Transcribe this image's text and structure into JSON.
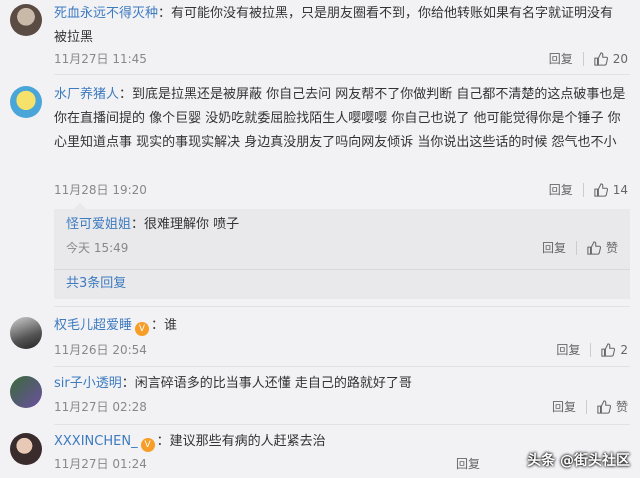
{
  "comments": [
    {
      "user": "死血永远不得灭种",
      "text": "：有可能你没有被拉黑，只是朋友圈看不到，你给他转账如果有名字就证明没有被拉黑",
      "time": "11月27日 11:45",
      "reply_label": "回复",
      "likes": "20"
    },
    {
      "user": "水厂养猪人",
      "text": "：到底是拉黑还是被屏蔽 你自己去问 网友帮不了你做判断 自己都不清楚的这点破事也是你在直播间提的 像个巨婴 没奶吃就委屈脸找陌生人嘤嘤嘤 你自己也说了 他可能觉得你是个锤子 你心里知道点事 现实的事现实解决 身边真没朋友了吗向网友倾诉 当你说出这些话的时候 怨气也不小",
      "time": "11月28日 19:20",
      "reply_label": "回复",
      "likes": "14",
      "reply": {
        "user": "怪可爱姐姐",
        "text": "：很难理解你 喷子",
        "time": "今天 15:49",
        "reply_label": "回复",
        "like_label": "赞",
        "more": "共3条回复"
      }
    },
    {
      "user": "权毛儿超爱睡",
      "badge": "V",
      "text": "：谁",
      "time": "11月26日 20:54",
      "reply_label": "回复",
      "likes": "2"
    },
    {
      "user": "sir子小透明",
      "text": "：闲言碎语多的比当事人还懂 走自己的路就好了哥",
      "time": "11月27日 02:28",
      "reply_label": "回复",
      "like_label": "赞"
    },
    {
      "user": "XXXINCHEN_",
      "badge": "V",
      "text": "：建议那些有病的人赶紧去治",
      "time": "11月27日 01:24",
      "reply_label": "回复"
    }
  ],
  "watermark": "头条 @街头社区"
}
